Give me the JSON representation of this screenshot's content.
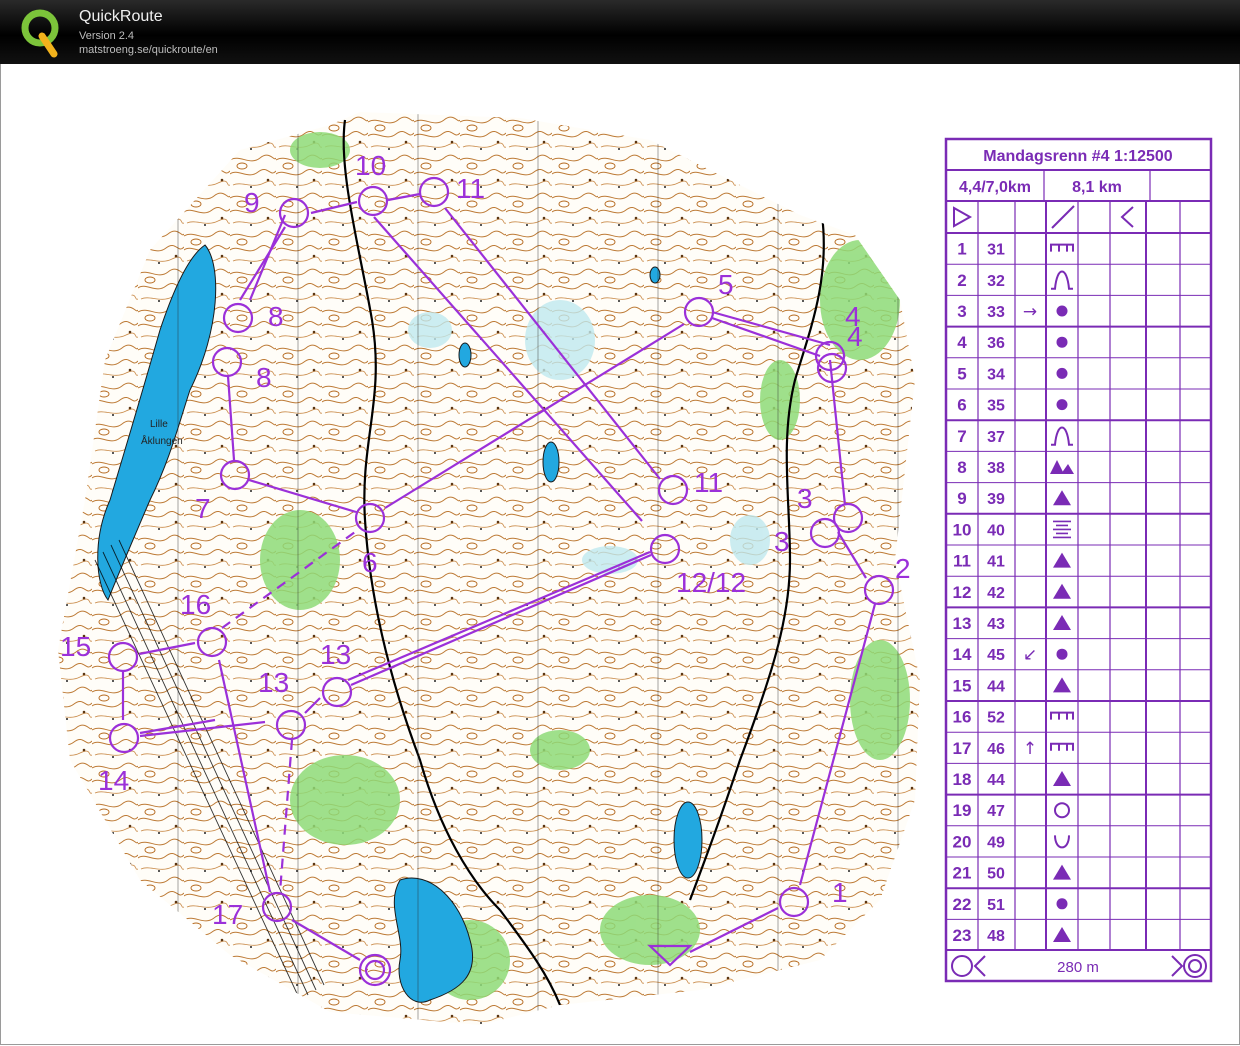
{
  "app": {
    "title": "QuickRoute",
    "version": "Version 2.4",
    "url": "matstroeng.se/quickroute/en"
  },
  "colors": {
    "course": "#9b30d9",
    "water": "#22a8e0",
    "forest": "#7fd36a",
    "contour": "#b5691e",
    "descriptions": "#7a2bb5"
  },
  "map": {
    "lake_label_line1": "Lille",
    "lake_label_line2": "Åklungen",
    "control_labels": [
      "1",
      "2",
      "3",
      "3",
      "4",
      "4",
      "5",
      "6",
      "7",
      "8",
      "8",
      "9",
      "10",
      "11",
      "11",
      "12/12",
      "13",
      "13",
      "14",
      "15",
      "16",
      "17"
    ]
  },
  "description_sheet": {
    "title": "Mandagsrenn #4 1:12500",
    "lengths": "4,4/7,0km",
    "climb": "8,1 km",
    "start_symbol": "start-triangle-icon",
    "rows": [
      {
        "no": "1",
        "code": "31",
        "dir": "",
        "sym": "fence"
      },
      {
        "no": "2",
        "code": "32",
        "dir": "",
        "sym": "knoll"
      },
      {
        "no": "3",
        "code": "33",
        "dir": "→",
        "sym": "dot"
      },
      {
        "no": "4",
        "code": "36",
        "dir": "",
        "sym": "dot"
      },
      {
        "no": "5",
        "code": "34",
        "dir": "",
        "sym": "dot"
      },
      {
        "no": "6",
        "code": "35",
        "dir": "",
        "sym": "dot"
      },
      {
        "no": "7",
        "code": "37",
        "dir": "",
        "sym": "knoll"
      },
      {
        "no": "8",
        "code": "38",
        "dir": "",
        "sym": "boulders"
      },
      {
        "no": "9",
        "code": "39",
        "dir": "",
        "sym": "triangle"
      },
      {
        "no": "10",
        "code": "40",
        "dir": "",
        "sym": "marsh"
      },
      {
        "no": "11",
        "code": "41",
        "dir": "",
        "sym": "triangle"
      },
      {
        "no": "12",
        "code": "42",
        "dir": "",
        "sym": "triangle"
      },
      {
        "no": "13",
        "code": "43",
        "dir": "",
        "sym": "triangle"
      },
      {
        "no": "14",
        "code": "45",
        "dir": "↙",
        "sym": "dot"
      },
      {
        "no": "15",
        "code": "44",
        "dir": "",
        "sym": "triangle"
      },
      {
        "no": "16",
        "code": "52",
        "dir": "",
        "sym": "fence"
      },
      {
        "no": "17",
        "code": "46",
        "dir": "↑",
        "sym": "fence"
      },
      {
        "no": "18",
        "code": "44",
        "dir": "",
        "sym": "triangle"
      },
      {
        "no": "19",
        "code": "47",
        "dir": "",
        "sym": "circle"
      },
      {
        "no": "20",
        "code": "49",
        "dir": "",
        "sym": "cup"
      },
      {
        "no": "21",
        "code": "50",
        "dir": "",
        "sym": "triangle"
      },
      {
        "no": "22",
        "code": "51",
        "dir": "",
        "sym": "dot"
      },
      {
        "no": "23",
        "code": "48",
        "dir": "",
        "sym": "triangle"
      }
    ],
    "finish_distance": "280 m"
  }
}
